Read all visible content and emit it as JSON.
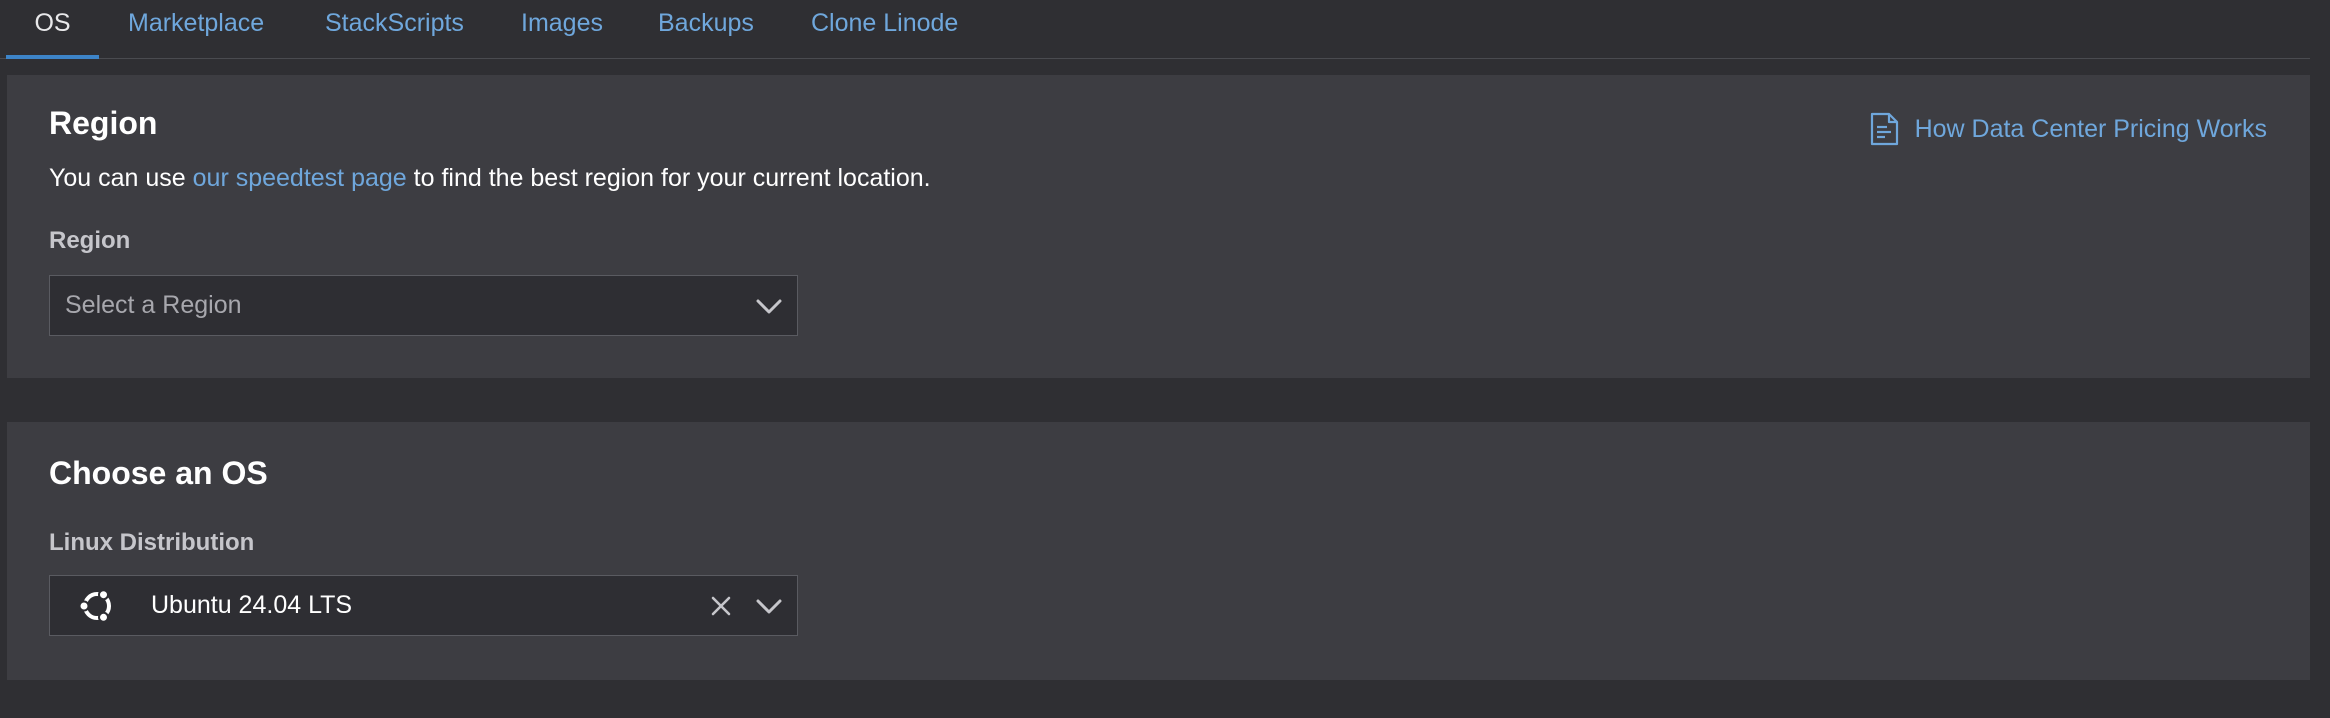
{
  "tabs": [
    {
      "label": "OS",
      "active": true
    },
    {
      "label": "Marketplace",
      "active": false
    },
    {
      "label": "StackScripts",
      "active": false
    },
    {
      "label": "Images",
      "active": false
    },
    {
      "label": "Backups",
      "active": false
    },
    {
      "label": "Clone Linode",
      "active": false
    }
  ],
  "region": {
    "title": "Region",
    "intro_prefix": "You can use ",
    "intro_link": "our speedtest page",
    "intro_suffix": " to find the best region for your current location.",
    "doc_link": "How Data Center Pricing Works",
    "doc_icon": "document-icon",
    "field_label": "Region",
    "select_placeholder": "Select a Region"
  },
  "os": {
    "title": "Choose an OS",
    "field_label": "Linux Distribution",
    "selected_value": "Ubuntu 24.04 LTS",
    "selected_icon": "ubuntu-logo-icon"
  },
  "colors": {
    "background": "#2f2f33",
    "panel": "#3d3d42",
    "link": "#6fa7dc",
    "active_tab_indicator": "#3d84c8",
    "input_background": "#2e2e33"
  }
}
